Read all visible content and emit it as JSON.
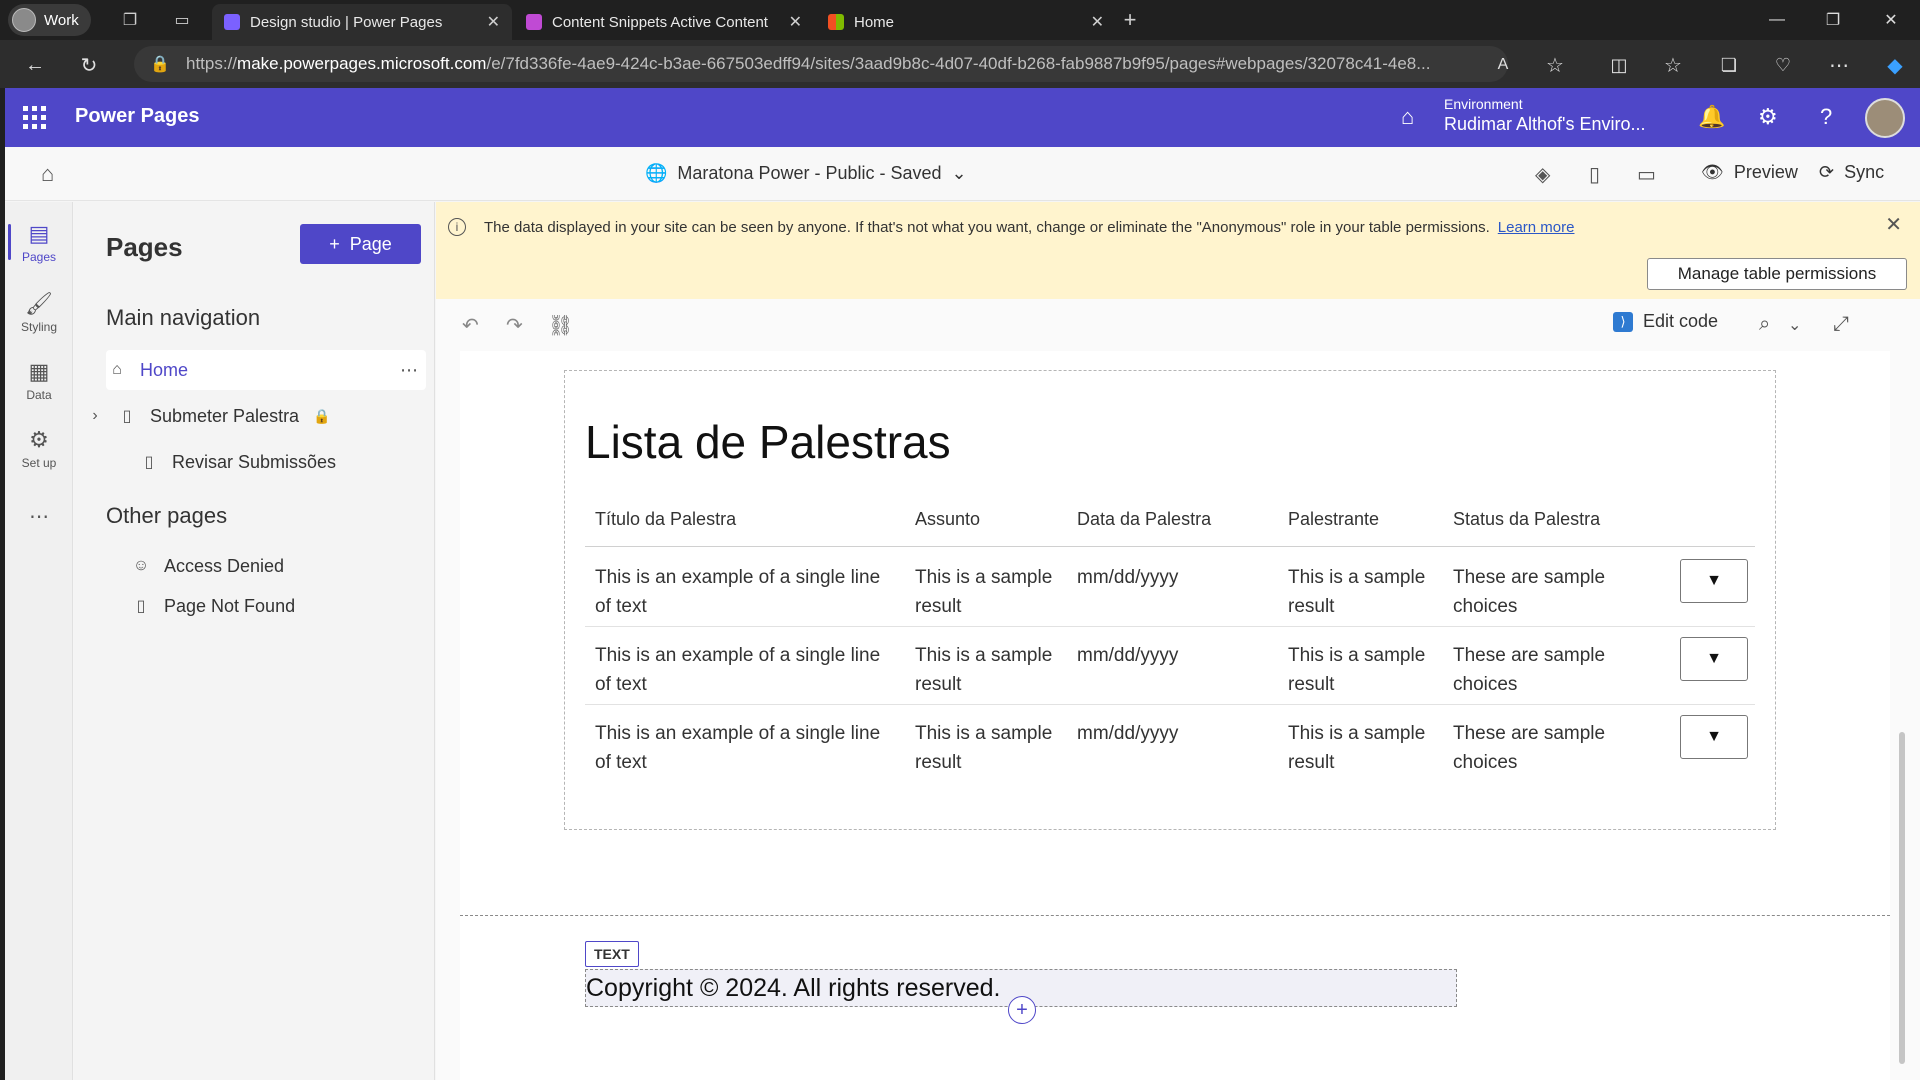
{
  "browser": {
    "profile": "Work",
    "tabs": [
      {
        "title": "Design studio | Power Pages",
        "color": "#7b61ff"
      },
      {
        "title": "Content Snippets Active Content",
        "color": "#c04ad4"
      },
      {
        "title": "Home",
        "color": "#f25022"
      }
    ],
    "url_prefix": "https://",
    "url_domain": "make.powerpages.microsoft.com",
    "url_rest": "/e/7fd336fe-4ae9-424c-b3ae-667503edff94/sites/3aad9b8c-4d07-40df-b268-fab9887b9f95/pages#webpages/32078c41-4e8..."
  },
  "suite": {
    "title": "Power Pages",
    "env_label": "Environment",
    "env_value": "Rudimar Althof's Enviro..."
  },
  "sitebar": {
    "site": "Maratona Power - Public - Saved",
    "preview": "Preview",
    "sync": "Sync"
  },
  "rail": [
    {
      "label": "Pages",
      "icon": "pages-icon"
    },
    {
      "label": "Styling",
      "icon": "brush-icon"
    },
    {
      "label": "Data",
      "icon": "table-icon"
    },
    {
      "label": "Set up",
      "icon": "setup-icon"
    }
  ],
  "pages_panel": {
    "title": "Pages",
    "add_label": "Page",
    "main_nav_title": "Main navigation",
    "main_nav": [
      "Home",
      "Submeter Palestra",
      "Revisar Submissões"
    ],
    "other_title": "Other pages",
    "other": [
      "Access Denied",
      "Page Not Found"
    ]
  },
  "banner": {
    "message": "The data displayed in your site can be seen by anyone. If that's not what you want, change or eliminate the \"Anonymous\" role in your table permissions.",
    "learn_more": "Learn more",
    "manage": "Manage table permissions"
  },
  "editor": {
    "edit_code": "Edit code"
  },
  "content": {
    "list_title": "Lista de Palestras",
    "headers": [
      "Título da Palestra",
      "Assunto",
      "Data da Palestra",
      "Palestrante",
      "Status da Palestra"
    ],
    "rows": [
      [
        "This is an example of a single line",
        "of text",
        "This is a sample",
        "result",
        "mm/dd/yyyy",
        "This is a sample",
        "result",
        "These are sample",
        "choices"
      ],
      [
        "This is an example of a single line",
        "of text",
        "This is a sample",
        "result",
        "mm/dd/yyyy",
        "This is a sample",
        "result",
        "These are sample",
        "choices"
      ],
      [
        "This is an example of a single line",
        "of text",
        "This is a sample",
        "result",
        "mm/dd/yyyy",
        "This is a sample",
        "result",
        "These are sample",
        "choices"
      ]
    ],
    "text_tag": "TEXT",
    "copyright": "Copyright © 2024. All rights reserved."
  },
  "colors": {
    "brand": "#4f47c8",
    "banner_bg": "#fff4ce"
  }
}
